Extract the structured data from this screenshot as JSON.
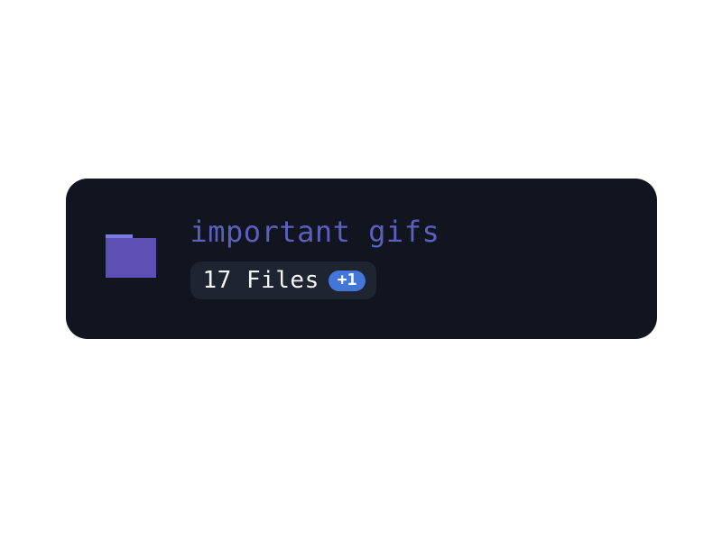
{
  "folder": {
    "name": "important gifs",
    "file_count_label": "17 Files",
    "additional_count": "+1"
  }
}
